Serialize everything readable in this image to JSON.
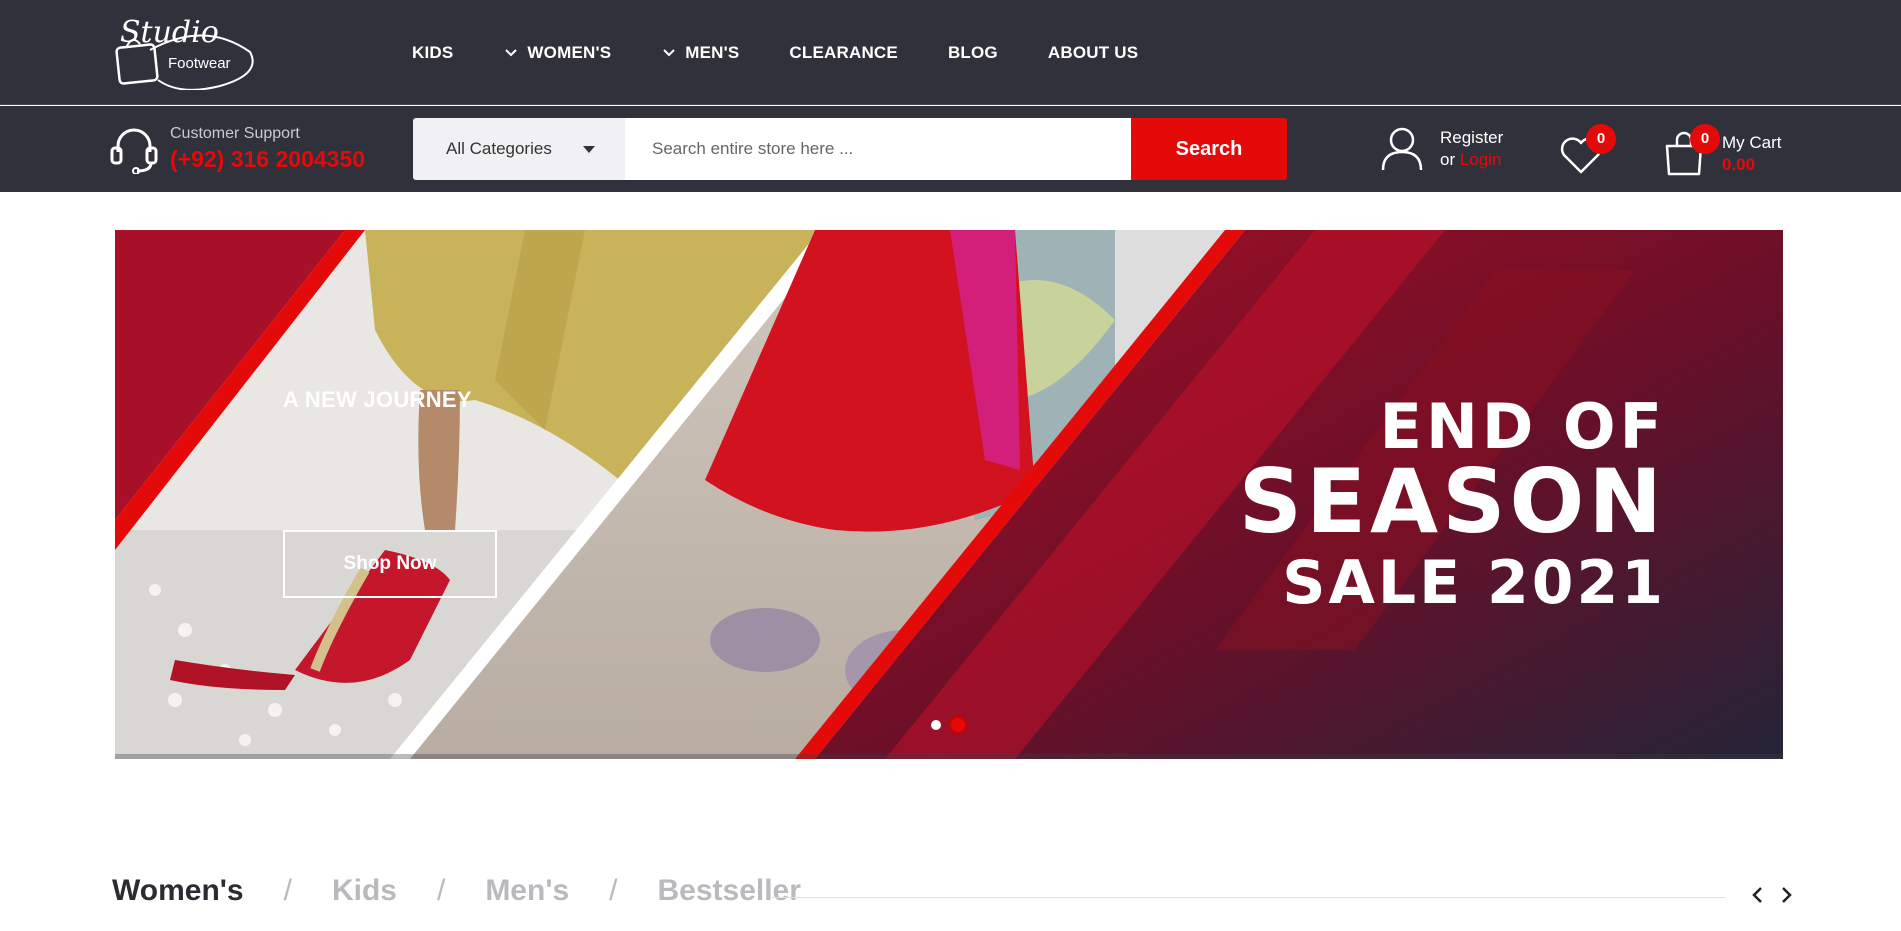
{
  "brand": {
    "logo_script": "Studio",
    "logo_word": "Footwear"
  },
  "nav": {
    "items": [
      {
        "label": "KIDS",
        "dropdown": false
      },
      {
        "label": "WOMEN'S",
        "dropdown": true
      },
      {
        "label": "MEN'S",
        "dropdown": true
      },
      {
        "label": "CLEARANCE",
        "dropdown": false
      },
      {
        "label": "BLOG",
        "dropdown": false
      },
      {
        "label": "ABOUT US",
        "dropdown": false
      }
    ]
  },
  "support": {
    "label": "Customer Support",
    "phone": "(+92) 316 2004350"
  },
  "search": {
    "category": "All Categories",
    "placeholder": "Search entire store here ...",
    "button": "Search"
  },
  "account": {
    "register": "Register",
    "or": "or ",
    "login": "Login"
  },
  "wishlist": {
    "count": "0"
  },
  "cart": {
    "count": "0",
    "label": "My Cart",
    "total": "0.00"
  },
  "banner": {
    "kicker": "A NEW JOURNEY",
    "button": "Shop Now",
    "headline_line1": "END OF",
    "headline_line2": "SEASON",
    "headline_line3": "SALE 2021",
    "slide_count": 2,
    "active_slide": 2
  },
  "category_tabs": {
    "items": [
      "Women's",
      "Kids",
      "Men's",
      "Bestseller"
    ],
    "active": 0,
    "separator": "/"
  },
  "colors": {
    "topbar": "#30313b",
    "accent": "#e50a0a",
    "tab_active": "#2a2b33",
    "tab_inactive": "#b9b9be"
  }
}
